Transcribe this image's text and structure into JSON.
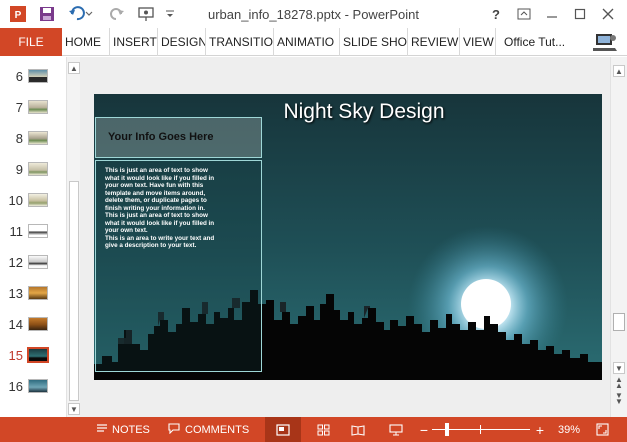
{
  "app": {
    "window_title": "urban_info_18278.pptx - PowerPoint",
    "help_glyph": "?",
    "icons": {
      "save": "save-icon",
      "undo": "undo-icon",
      "redo": "redo-icon",
      "start_from_beginning": "slideshow-start-icon",
      "customize": "customize-quick-access-icon",
      "help": "help-icon",
      "ribbon_display": "ribbon-display-options-icon",
      "minimize": "minimize-icon",
      "maximize": "maximize-icon",
      "close": "close-icon",
      "powerpoint_logo": "powerpoint-logo-icon"
    },
    "accent_color": "#d24726"
  },
  "ribbon": {
    "file_label": "FILE",
    "tabs": [
      "HOME",
      "INSERT",
      "DESIGN",
      "TRANSITIO",
      "ANIMATIO",
      "SLIDE SHO",
      "REVIEW",
      "VIEW"
    ],
    "user_label": "Office Tut..."
  },
  "thumbnails": {
    "numbers": [
      "6",
      "7",
      "8",
      "9",
      "10",
      "11",
      "12",
      "13",
      "14",
      "15",
      "16"
    ],
    "active_number": "15"
  },
  "slide": {
    "title": "Night Sky Design",
    "info_heading": "Your Info Goes Here",
    "body_lines": [
      "This is just an area of text to show",
      "what it would look like if you filled in",
      "your own text. Have fun with this",
      "template and move items around,",
      "delete them, or duplicate pages to",
      "finish writing your information in.",
      "This is just an area of text to show",
      "what it would look like if you filled in",
      "your own text.",
      "This is an area to write your text and",
      "give a description to your text."
    ]
  },
  "statusbar": {
    "notes_label": "NOTES",
    "comments_label": "COMMENTS",
    "zoom_minus": "−",
    "zoom_plus": "+",
    "zoom_percent": "39%",
    "zoom_level": 0.39
  }
}
